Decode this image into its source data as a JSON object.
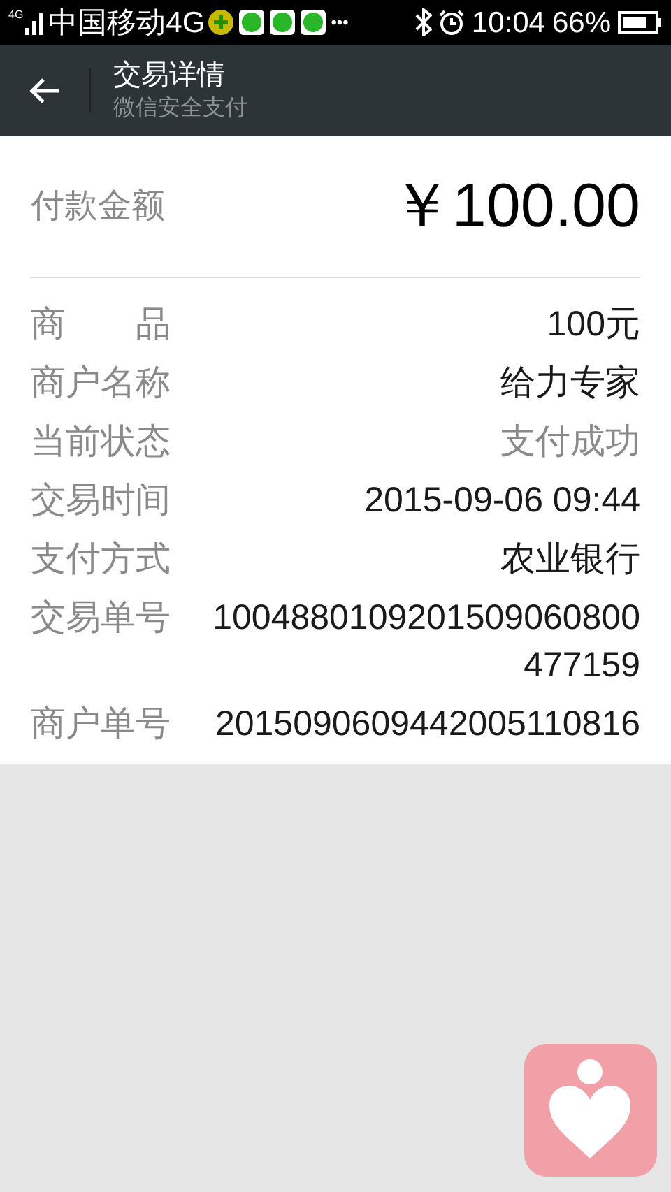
{
  "status_bar": {
    "network_tag": "4G",
    "carrier": "中国移动4G",
    "more": "•••",
    "time": "10:04",
    "battery_percent": "66%"
  },
  "header": {
    "title": "交易详情",
    "subtitle": "微信安全支付"
  },
  "amount": {
    "label": "付款金额",
    "value": "￥100.00"
  },
  "details": [
    {
      "label": "商　　品",
      "value": "100元",
      "kind": "dark"
    },
    {
      "label": "商户名称",
      "value": "给力专家",
      "kind": "dark"
    },
    {
      "label": "当前状态",
      "value": "支付成功",
      "kind": "muted"
    },
    {
      "label": "交易时间",
      "value": "2015-09-06 09:44",
      "kind": "dark"
    },
    {
      "label": "支付方式",
      "value": "农业银行",
      "kind": "dark"
    },
    {
      "label": "交易单号",
      "value": "1004880109201509060800477159",
      "kind": "dark"
    },
    {
      "label": "商户单号",
      "value": "2015090609442005110816",
      "kind": "dark"
    }
  ]
}
